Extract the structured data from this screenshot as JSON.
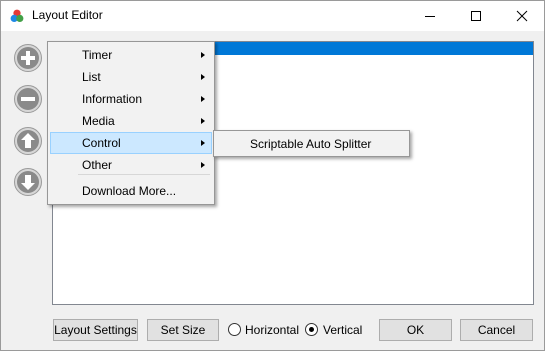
{
  "window": {
    "title": "Layout Editor",
    "icon": "livesplit-logo-icon"
  },
  "caption_buttons": {
    "minimize": "minimize-icon",
    "maximize": "maximize-icon",
    "close": "close-icon"
  },
  "side_buttons": [
    {
      "name": "add-component",
      "icon": "plus-icon"
    },
    {
      "name": "remove-component",
      "icon": "minus-icon"
    },
    {
      "name": "move-up",
      "icon": "arrow-up-icon"
    },
    {
      "name": "move-down",
      "icon": "arrow-down-icon"
    }
  ],
  "context_menu": {
    "items": [
      {
        "label": "Timer",
        "submenu": true
      },
      {
        "label": "List",
        "submenu": true
      },
      {
        "label": "Information",
        "submenu": true
      },
      {
        "label": "Media",
        "submenu": true
      },
      {
        "label": "Control",
        "submenu": true,
        "highlighted": true
      },
      {
        "label": "Other",
        "submenu": true
      },
      {
        "label": "Download More...",
        "submenu": false
      }
    ],
    "submenu": {
      "items": [
        {
          "label": "Scriptable Auto Splitter"
        }
      ]
    }
  },
  "bottom": {
    "layout_settings_label": "Layout Settings",
    "set_size_label": "Set Size",
    "orientation": {
      "horizontal_label": "Horizontal",
      "vertical_label": "Vertical",
      "selected": "Vertical"
    },
    "ok_label": "OK",
    "cancel_label": "Cancel"
  },
  "colors": {
    "selection": "#0078d7",
    "menu_highlight": "#cce8ff",
    "menu_highlight_border": "#99d1ff",
    "side_button_fill": "#888888"
  }
}
